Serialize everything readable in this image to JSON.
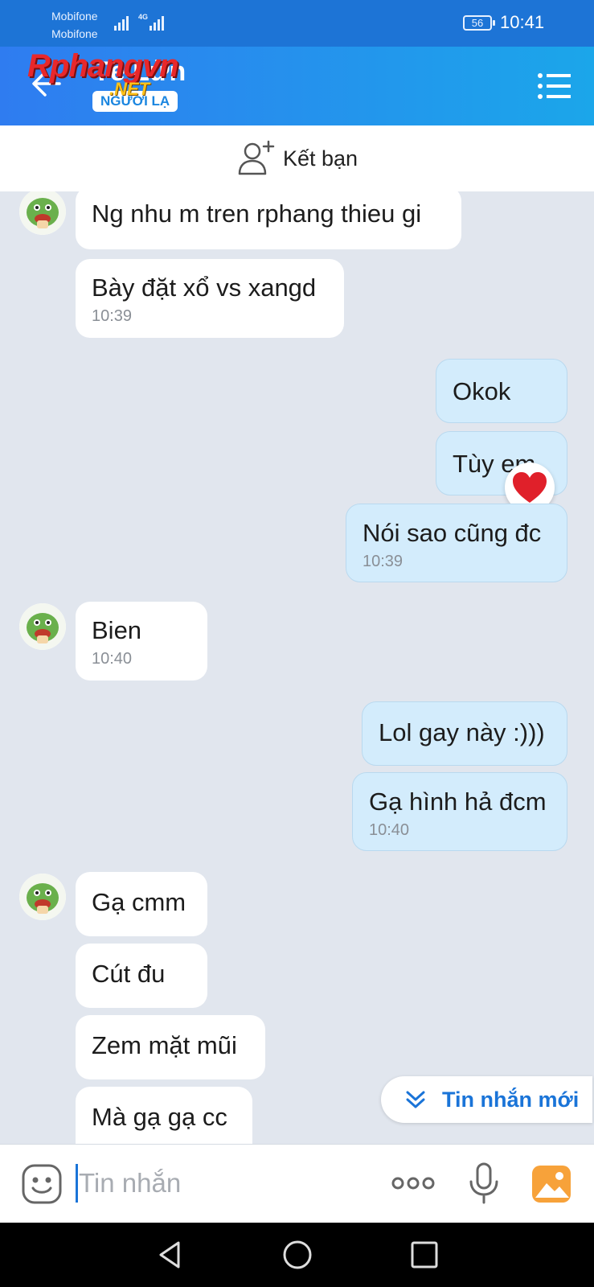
{
  "status_bar": {
    "carrier_1": "Mobifone",
    "carrier_2": "Mobifone",
    "network": "4G",
    "battery": "56",
    "time": "10:41"
  },
  "header": {
    "contact_name": "Tê Lửn",
    "badge": "NGƯỜI LẠ",
    "watermark": "Rphangvn",
    "watermark_suffix": ".NET",
    "back_icon": "arrow-left-icon",
    "menu_icon": "menu-icon"
  },
  "add_friend": {
    "label": "Kết bạn",
    "icon": "add-user-icon"
  },
  "messages": [
    {
      "direction": "in",
      "text": "Ng nhu m tren rphang thieu gi",
      "time": ""
    },
    {
      "direction": "in",
      "text": "Bày đặt xổ vs xangd",
      "time": "10:39"
    },
    {
      "direction": "out",
      "text": "Okok",
      "time": ""
    },
    {
      "direction": "out",
      "text": "Tùy em",
      "time": ""
    },
    {
      "direction": "out",
      "text": "Nói sao cũng đc",
      "time": "10:39"
    },
    {
      "direction": "in",
      "text": "Bien",
      "time": "10:40"
    },
    {
      "direction": "out",
      "text": "Lol gay này :)))",
      "time": ""
    },
    {
      "direction": "out",
      "text": "Gạ hình hả đcm",
      "time": "10:40"
    },
    {
      "direction": "in",
      "text": "Gạ cmm",
      "time": ""
    },
    {
      "direction": "in",
      "text": "Cút đu",
      "time": ""
    },
    {
      "direction": "in",
      "text": "Zem mặt mũi",
      "time": ""
    },
    {
      "direction": "in",
      "text": "Mà gạ gạ cc",
      "time": ""
    }
  ],
  "reaction": "heart-icon",
  "new_messages_button": {
    "label": "Tin nhắn mới",
    "icon": "chevron-double-down-icon"
  },
  "composer": {
    "placeholder": "Tin nhắn",
    "value": "",
    "emoji_icon": "emoji-icon",
    "more_icon": "more-dots-icon",
    "mic_icon": "microphone-icon",
    "gallery_icon": "gallery-icon"
  },
  "colors": {
    "header_start": "#2f7cf0",
    "header_end": "#1ba6ea",
    "chat_background": "#e1e6ee",
    "outgoing_bubble": "#d3ecfc",
    "incoming_bubble": "#ffffff",
    "accent": "#1a74d8"
  }
}
